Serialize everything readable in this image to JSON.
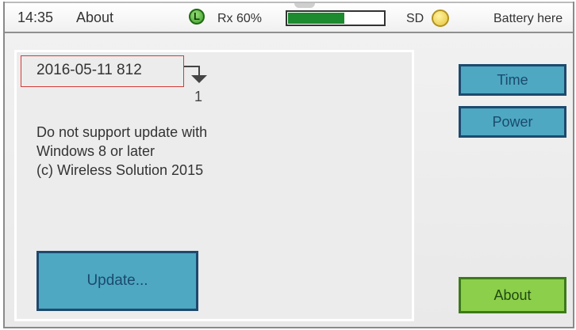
{
  "statusbar": {
    "time": "14:35",
    "screen_title": "About",
    "l_badge": "L",
    "rx_label": "Rx 60%",
    "signal_level": 0.6,
    "sd_label": "SD",
    "battery_label": "Battery here"
  },
  "info": {
    "version_line": "2016-05-11   812",
    "annotation_number": "1",
    "message_lines": [
      "Do not support update with",
      "Windows 8 or later",
      "(c) Wireless Solution 2015"
    ]
  },
  "buttons": {
    "update": "Update...",
    "time": "Time",
    "power": "Power",
    "about": "About"
  },
  "colors": {
    "signal_fill": "#1c8a2e",
    "button_blue": "#4ea8c2",
    "button_green": "#8ccf4a",
    "highlight_red": "#d43a3a"
  },
  "icons": {
    "l_badge": "l-status-icon",
    "sd": "sd-indicator-icon",
    "arrow": "down-arrow-icon"
  }
}
